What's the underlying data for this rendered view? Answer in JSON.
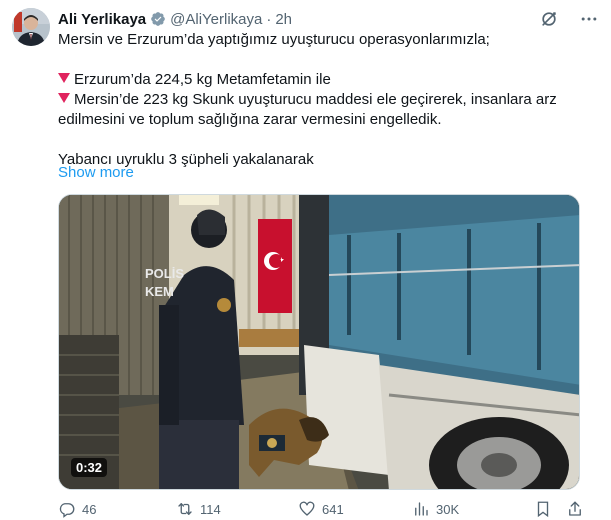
{
  "author": {
    "name": "Ali Yerlikaya",
    "handle": "@AliYerlikaya",
    "separator": "·",
    "time": "2h"
  },
  "tweet": {
    "line1": "Mersin ve Erzurum’da yaptığımız uyuşturucu operasyonlarımızla;",
    "line2": "Erzurum’da 224,5 kg Metamfetamin ile",
    "line3": "Mersin’de 223 kg Skunk uyuşturucu maddesi ele geçirerek, insanlara arz",
    "line4": "edilmesini ve toplum sağlığına zarar vermesini engelledik.",
    "line5": "Yabancı uyruklu 3 şüpheli yakalanarak",
    "show_more": "Show more"
  },
  "media": {
    "vest_text_1": "POLİS",
    "vest_text_2": "KEM",
    "duration": "0:32"
  },
  "actions": {
    "replies": "46",
    "reposts": "114",
    "likes": "641",
    "views": "30K"
  },
  "colors": {
    "link": "#1d9bf0",
    "secondary_text": "#536471",
    "verified": "#829aab",
    "bullet_triangle": "#e0245e"
  }
}
